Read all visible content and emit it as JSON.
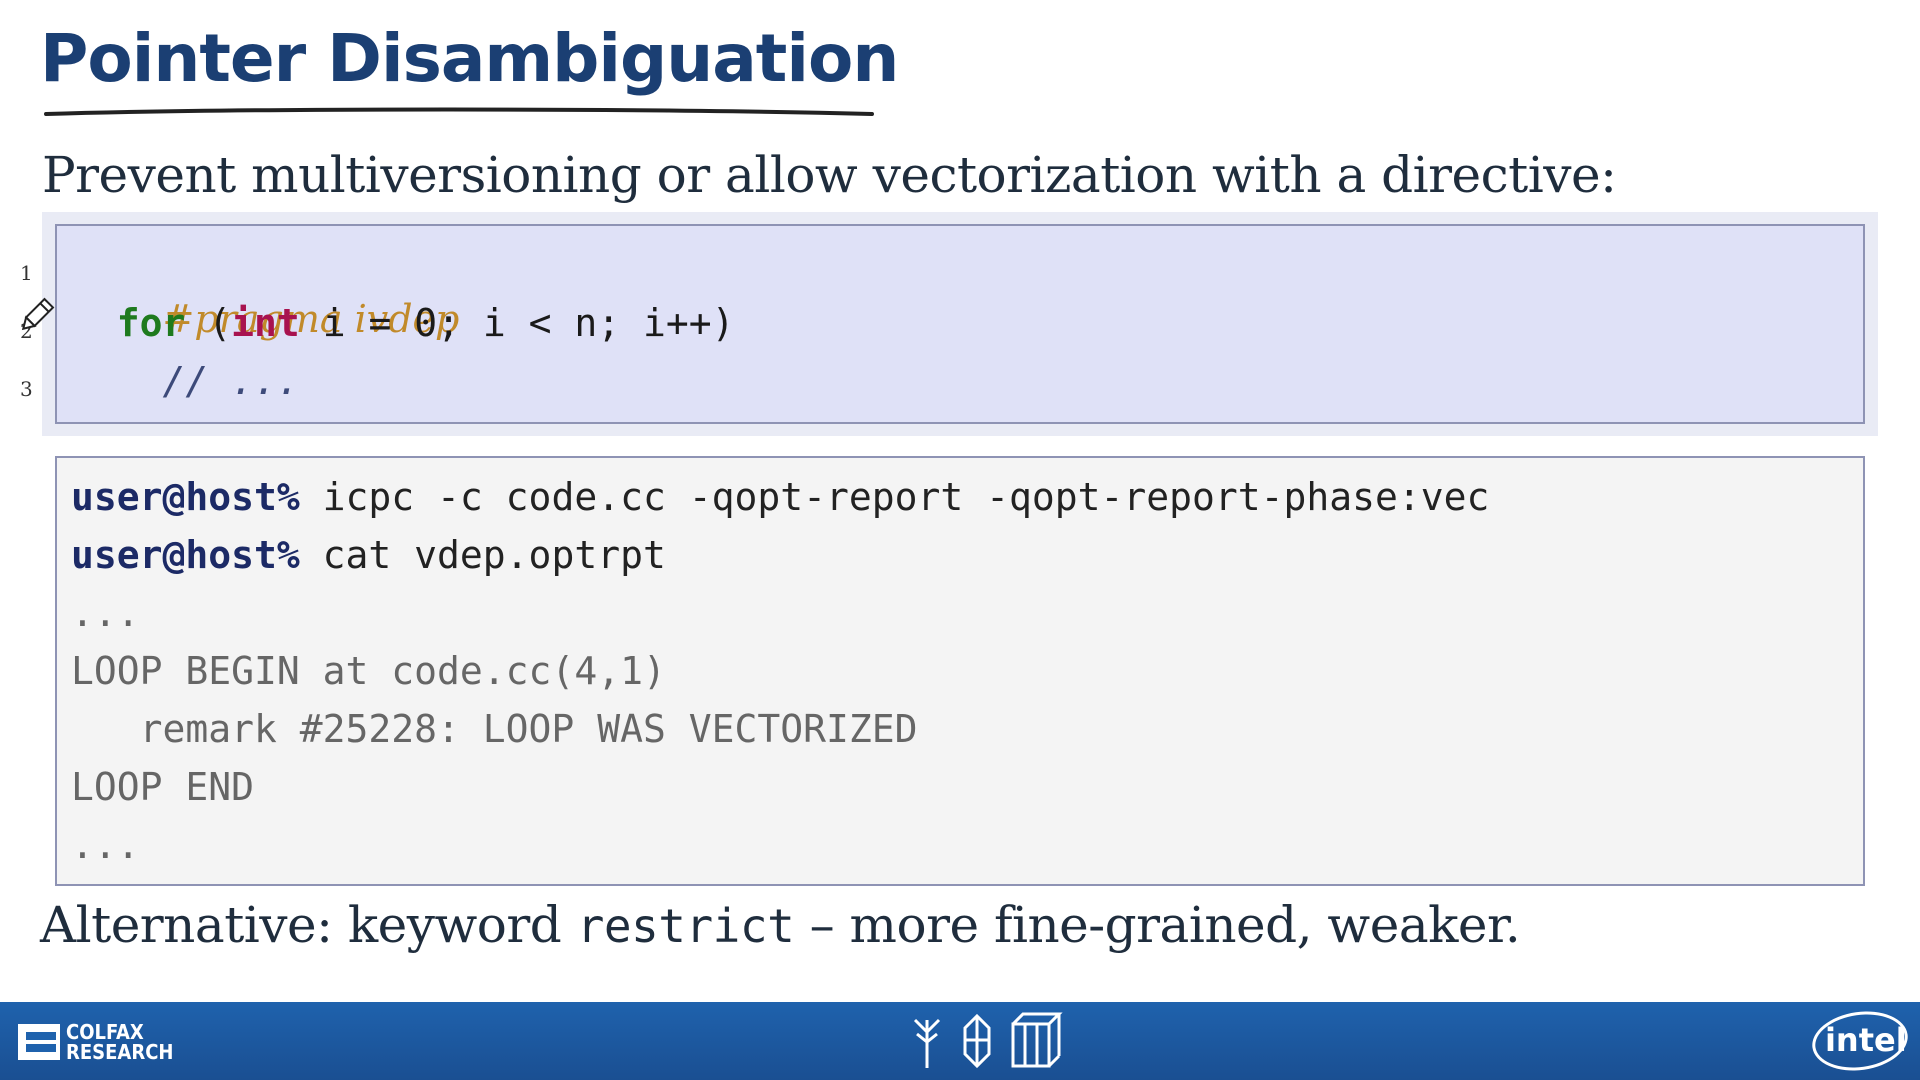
{
  "slide": {
    "title": "Pointer Disambiguation",
    "subtitle": "Prevent multiversioning or allow vectorization with a directive:",
    "alternative_prefix": "Alternative: keyword ",
    "alternative_keyword": "restrict",
    "alternative_suffix": " – more fine-grained, weaker."
  },
  "code": {
    "line_numbers": [
      "1",
      "2",
      "3"
    ],
    "line1": "#pragma ivdep",
    "line2_indent": "  ",
    "line2_for": "for",
    "line2_open": " (",
    "line2_int": "int",
    "line2_rest": " i = 0; i < n; i++)",
    "line3": "    // ..."
  },
  "terminal": {
    "prompt1": "user@host%",
    "cmd1": " icpc -c code.cc -qopt-report -qopt-report-phase:vec",
    "prompt2": "user@host%",
    "cmd2": " cat vdep.optrpt",
    "ellipsis1": "...",
    "loop_begin": "LOOP BEGIN at code.cc(4,1)",
    "remark": "   remark #25228: LOOP WAS VECTORIZED",
    "loop_end": "LOOP END",
    "ellipsis2": "..."
  },
  "footer": {
    "brand_line1": "COLFAX",
    "brand_line2": "RESEARCH",
    "intel_label": "intel",
    "background_color": "#1f62ad",
    "icons": [
      "tree-icon",
      "crystal-icon",
      "cube-icon"
    ]
  },
  "colors": {
    "title": "#1b3f73",
    "pragma": "#c18a2a",
    "keyword_for": "#1e7a1e",
    "keyword_int": "#a8124f",
    "prompt": "#1c2a66"
  }
}
